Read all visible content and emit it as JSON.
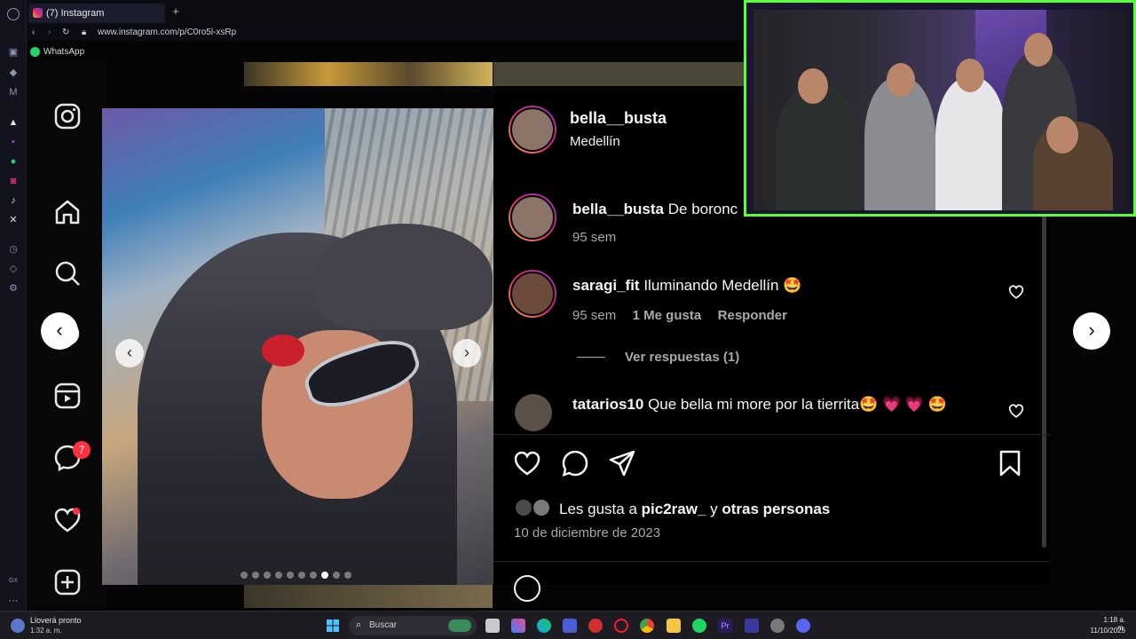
{
  "browser": {
    "tab_title": "(7) Instagram",
    "url": "www.instagram.com/p/C0ro5l-xsRp",
    "bookmark_label": "WhatsApp"
  },
  "sidebar": {
    "messages_badge": "7"
  },
  "post": {
    "author": {
      "username": "bella__busta",
      "location": "Medellín"
    },
    "comments": [
      {
        "username": "bella__busta",
        "text": "De boronc",
        "meta": {
          "time": "95 sem"
        }
      },
      {
        "username": "saragi_fit",
        "text": "Iluminando Medellín 🤩",
        "meta": {
          "time": "95 sem",
          "likes": "1 Me gusta",
          "reply": "Responder"
        },
        "view_replies": "Ver respuestas (1)"
      },
      {
        "username": "tatarios10",
        "text": "Que bella mi more por la tierrita🤩 💗 💗 🤩"
      }
    ],
    "likes": {
      "prefix": "Les gusta a",
      "user": "pic2raw_",
      "joiner": "y",
      "others": "otras personas"
    },
    "date": "10 de diciembre de 2023",
    "carousel": {
      "count": 10,
      "active": 7
    }
  },
  "taskbar": {
    "weather_title": "Lloverá pronto",
    "weather_time": "1:32 a. m.",
    "search_placeholder": "Buscar",
    "clock_time": "1:18 a. m.",
    "clock_date": "11/10/2025"
  },
  "colors": {
    "ig_gradient": "#d62976",
    "cam_border": "#58ff3a",
    "heart_red": "#ff3040"
  }
}
